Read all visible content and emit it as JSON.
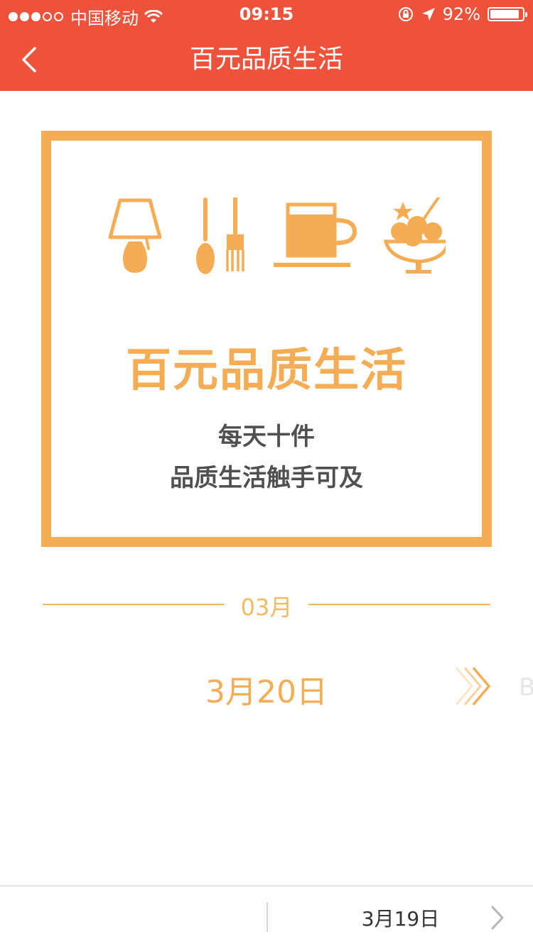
{
  "status_bar": {
    "carrier": "中国移动",
    "time": "09:15",
    "battery_text": "92%",
    "battery_level": 0.92
  },
  "nav": {
    "title": "百元品质生活",
    "back_icon": "chevron-left-icon"
  },
  "poster": {
    "icons": [
      "lamp-icon",
      "spoon-fork-icon",
      "coffee-cup-icon",
      "ice-cream-icon"
    ],
    "title": "百元品质生活",
    "subtitle_line1": "每天十件",
    "subtitle_line2": "品质生活触手可及"
  },
  "month": "03月",
  "current_date": "3月20日",
  "next_peek_text": "B",
  "bottom_bar": {
    "next_date": "3月19日",
    "next_icon": "chevron-right-icon"
  },
  "colors": {
    "brand_red": "#ee523b",
    "accent_orange": "#f4ad55",
    "text_dark": "#505050"
  }
}
